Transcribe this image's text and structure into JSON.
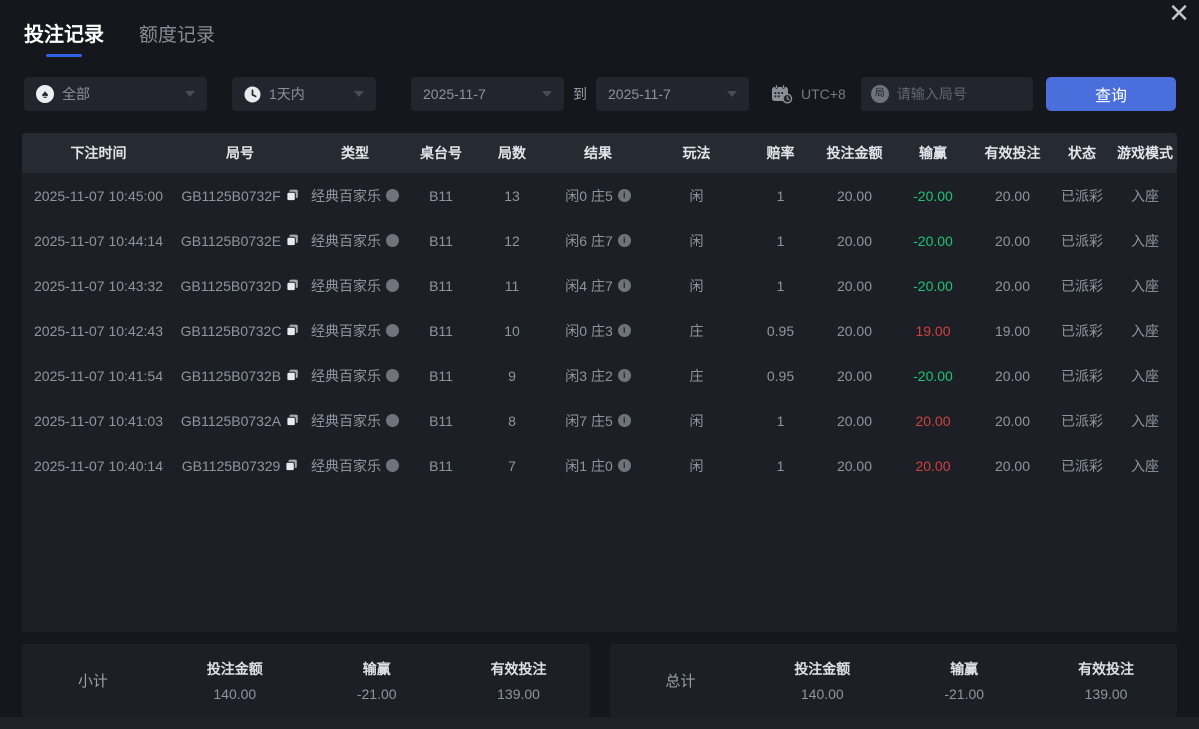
{
  "window": {
    "close_label": "×"
  },
  "icons": {
    "spade": "♠",
    "round_badge": "局",
    "info": "i"
  },
  "tabs": [
    {
      "label": "投注记录",
      "active": true
    },
    {
      "label": "额度记录",
      "active": false
    }
  ],
  "filters": {
    "game_type": "全部",
    "time_range": "1天内",
    "date_from": "2025-11-7",
    "to_label": "到",
    "date_to": "2025-11-7",
    "timezone": "UTC+8",
    "round_placeholder": "请输入局号",
    "search_label": "查询"
  },
  "table": {
    "columns": [
      "下注时间",
      "局号",
      "类型",
      "桌台号",
      "局数",
      "结果",
      "玩法",
      "赔率",
      "投注金额",
      "输赢",
      "有效投注",
      "状态",
      "游戏模式"
    ],
    "rows": [
      {
        "time": "2025-11-07 10:45:00",
        "round_id": "GB1125B0732F",
        "type": "经典百家乐",
        "table_no": "B11",
        "round_no": "13",
        "result": "闲0 庄5",
        "play": "闲",
        "odds": "1",
        "bet": "20.00",
        "win_loss": "-20.00",
        "win_loss_color": "green",
        "valid_bet": "20.00",
        "status": "已派彩",
        "mode": "入座"
      },
      {
        "time": "2025-11-07 10:44:14",
        "round_id": "GB1125B0732E",
        "type": "经典百家乐",
        "table_no": "B11",
        "round_no": "12",
        "result": "闲6 庄7",
        "play": "闲",
        "odds": "1",
        "bet": "20.00",
        "win_loss": "-20.00",
        "win_loss_color": "green",
        "valid_bet": "20.00",
        "status": "已派彩",
        "mode": "入座"
      },
      {
        "time": "2025-11-07 10:43:32",
        "round_id": "GB1125B0732D",
        "type": "经典百家乐",
        "table_no": "B11",
        "round_no": "11",
        "result": "闲4 庄7",
        "play": "闲",
        "odds": "1",
        "bet": "20.00",
        "win_loss": "-20.00",
        "win_loss_color": "green",
        "valid_bet": "20.00",
        "status": "已派彩",
        "mode": "入座"
      },
      {
        "time": "2025-11-07 10:42:43",
        "round_id": "GB1125B0732C",
        "type": "经典百家乐",
        "table_no": "B11",
        "round_no": "10",
        "result": "闲0 庄3",
        "play": "庄",
        "odds": "0.95",
        "bet": "20.00",
        "win_loss": "19.00",
        "win_loss_color": "red",
        "valid_bet": "19.00",
        "status": "已派彩",
        "mode": "入座"
      },
      {
        "time": "2025-11-07 10:41:54",
        "round_id": "GB1125B0732B",
        "type": "经典百家乐",
        "table_no": "B11",
        "round_no": "9",
        "result": "闲3 庄2",
        "play": "庄",
        "odds": "0.95",
        "bet": "20.00",
        "win_loss": "-20.00",
        "win_loss_color": "green",
        "valid_bet": "20.00",
        "status": "已派彩",
        "mode": "入座"
      },
      {
        "time": "2025-11-07 10:41:03",
        "round_id": "GB1125B0732A",
        "type": "经典百家乐",
        "table_no": "B11",
        "round_no": "8",
        "result": "闲7 庄5",
        "play": "闲",
        "odds": "1",
        "bet": "20.00",
        "win_loss": "20.00",
        "win_loss_color": "red",
        "valid_bet": "20.00",
        "status": "已派彩",
        "mode": "入座"
      },
      {
        "time": "2025-11-07 10:40:14",
        "round_id": "GB1125B07329",
        "type": "经典百家乐",
        "table_no": "B11",
        "round_no": "7",
        "result": "闲1 庄0",
        "play": "闲",
        "odds": "1",
        "bet": "20.00",
        "win_loss": "20.00",
        "win_loss_color": "red",
        "valid_bet": "20.00",
        "status": "已派彩",
        "mode": "入座"
      }
    ]
  },
  "summary": {
    "labels": {
      "bet_amount": "投注金额",
      "win_loss": "输赢",
      "valid_bet": "有效投注"
    },
    "subtotal": {
      "title": "小计",
      "bet_amount": "140.00",
      "win_loss": "-21.00",
      "win_loss_color": "green",
      "valid_bet": "139.00"
    },
    "total": {
      "title": "总计",
      "bet_amount": "140.00",
      "win_loss": "-21.00",
      "win_loss_color": "green",
      "valid_bet": "139.00"
    }
  },
  "colors": {
    "accent_blue": "#4a6fdd",
    "tab_underline": "#2e62e4",
    "win_red": "#cf4141",
    "loss_green": "#1ec473",
    "panel_bg": "#1c1f25",
    "header_bg": "#262a33"
  }
}
